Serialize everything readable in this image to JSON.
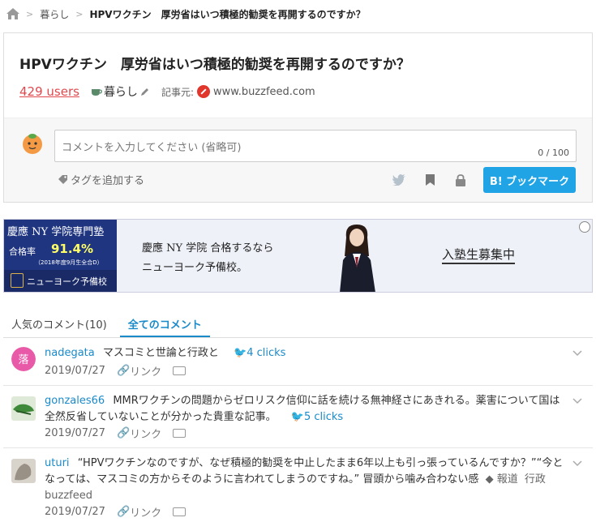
{
  "breadcrumb": {
    "category": "暮らし",
    "current": "HPVワクチン　厚労省はいつ積極的勧奨を再開するのですか？"
  },
  "entry": {
    "title": "HPVワクチン　厚労省はいつ積極的勧奨を再開するのですか？",
    "users": "429 users",
    "category": "暮らし",
    "source_label": "記事元:",
    "domain": "www.buzzfeed.com"
  },
  "comment_form": {
    "placeholder": "コメントを入力してください (省略可)",
    "counter": "0 / 100",
    "add_tag": "タグを追加する",
    "bookmark_button": "B! ブックマーク"
  },
  "ad": {
    "school": "慶應 NY 学院専門塾",
    "rate_label": "合格率",
    "rate": "91.4%",
    "note": "（2018年度9月生全合D）",
    "brand": "ニューヨーク予備校",
    "line1": "慶應 NY 学院 合格するなら",
    "line2": "ニューヨーク予備校。",
    "cta": "入塾生募集中"
  },
  "tabs": [
    {
      "label": "人気のコメント(10)"
    },
    {
      "label": "全てのコメント"
    }
  ],
  "comments": [
    {
      "user": "nadegata",
      "text": "マスコミと世論と行政と",
      "clicks": "4 clicks",
      "date": "2019/07/27",
      "link": "リンク"
    },
    {
      "user": "gonzales66",
      "text": "MMRワクチンの問題からゼロリスク信仰に話を続ける無神経さにあきれる。薬害について国は全然反省していないことが分かった貴重な記事。",
      "clicks": "5 clicks",
      "date": "2019/07/27",
      "link": "リンク"
    },
    {
      "user": "uturi",
      "text": "“HPVワクチンなのですが、なぜ積極的勧奨を中止したまま6年以上も引っ張っているんですか？”“今となっては、マスコミの方からそのように言われてしまうのですね。” 冒頭から噛み合わない感",
      "tags": [
        "報道",
        "行政",
        "buzzfeed"
      ],
      "date": "2019/07/27",
      "link": "リンク"
    }
  ],
  "colors": {
    "accent": "#1a8ac9",
    "users": "#e0484d",
    "bookmark_btn": "#21a4e6"
  }
}
